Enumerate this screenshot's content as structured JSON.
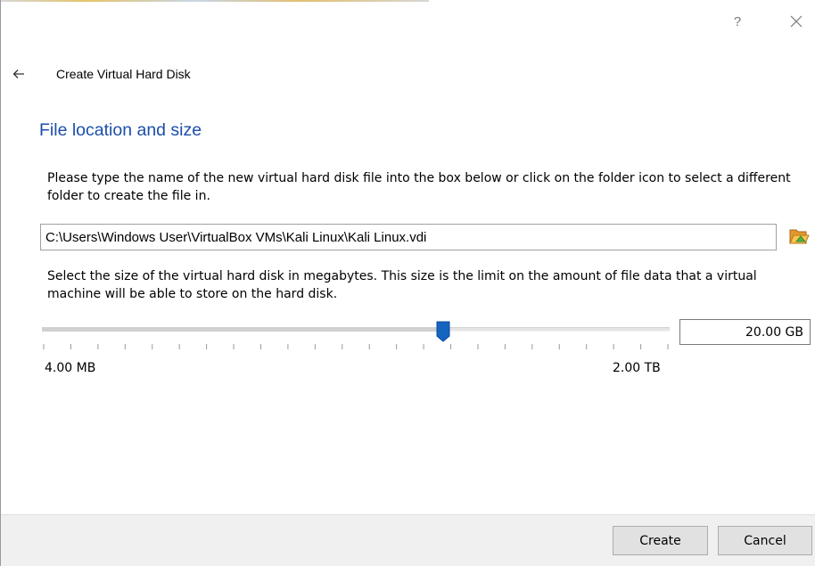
{
  "titlebar": {
    "help_label": "?"
  },
  "wizard": {
    "title": "Create Virtual Hard Disk",
    "section_title": "File location and size",
    "location_description": "Please type the name of the new virtual hard disk file into the box below or click on the folder icon to select a different folder to create the file in.",
    "file_path": "C:\\Users\\Windows User\\VirtualBox VMs\\Kali Linux\\Kali Linux.vdi",
    "size_description": "Select the size of the virtual hard disk in megabytes. This size is the limit on the amount of file data that a virtual machine will be able to store on the hard disk.",
    "size_value": "20.00 GB",
    "slider": {
      "position_fraction": 0.64,
      "tick_count": 24
    },
    "min_size_label": "4.00 MB",
    "max_size_label": "2.00 TB"
  },
  "buttons": {
    "create": "Create",
    "cancel": "Cancel"
  },
  "icons": {
    "back": "arrow-left-icon",
    "close": "close-icon",
    "folder": "folder-open-icon"
  },
  "colors": {
    "section_title": "#1c4eaa",
    "slider_handle": "#1565c0",
    "footer_bg": "#f0f0f0",
    "button_bg": "#e1e1e1"
  }
}
